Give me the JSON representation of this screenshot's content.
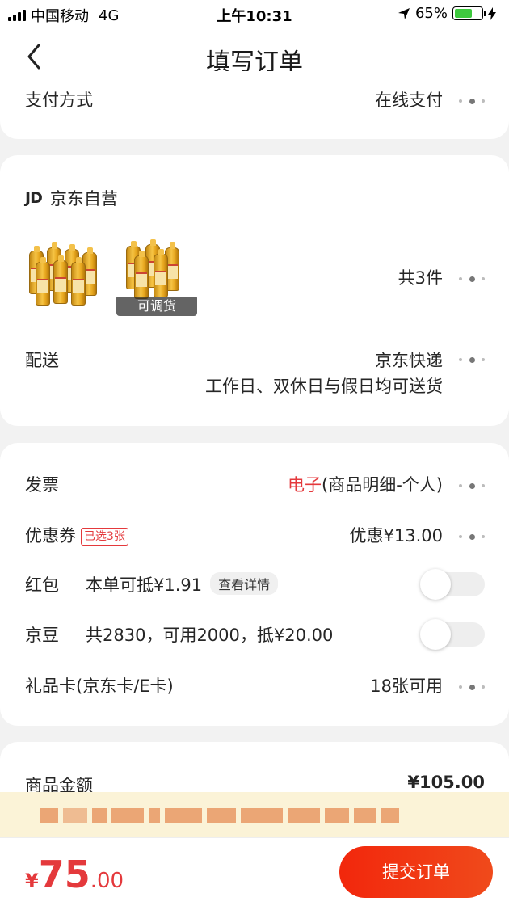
{
  "status_bar": {
    "carrier": "中国移动",
    "network": "4G",
    "time": "上午10:31",
    "battery_pct": "65%",
    "battery_level": 0.65
  },
  "nav": {
    "title": "填写订单",
    "back_icon": "chevron-left-icon"
  },
  "payment": {
    "label": "支付方式",
    "value": "在线支付"
  },
  "store": {
    "logo": "JD",
    "name": "京东自营",
    "product_badge": "可调货",
    "quantity": "共3件",
    "delivery": {
      "label": "配送",
      "carrier": "京东快递",
      "note": "工作日、双休日与假日均可送货"
    }
  },
  "promo": {
    "invoice": {
      "label": "发票",
      "type": "电子",
      "detail": "(商品明细-个人)"
    },
    "coupon": {
      "label": "优惠券",
      "tag": "已选3张",
      "value": "优惠¥13.00"
    },
    "red_packet": {
      "label": "红包",
      "desc": "本单可抵¥1.91",
      "detail_btn": "查看详情",
      "enabled": false
    },
    "jd_beans": {
      "label": "京豆",
      "desc": "共2830，可用2000，抵¥20.00",
      "enabled": false
    },
    "gift_card": {
      "label": "礼品卡(京东卡/E卡)",
      "value": "18张可用"
    }
  },
  "summary": {
    "goods_label": "商品金额",
    "goods_value": "¥105.00"
  },
  "bottom": {
    "currency": "¥",
    "total_int": "75",
    "total_dec": ".00",
    "submit_label": "提交订单"
  },
  "colors": {
    "accent": "#e4393c",
    "submit": "#f2270c",
    "notice_bg": "#fbf3d7"
  }
}
